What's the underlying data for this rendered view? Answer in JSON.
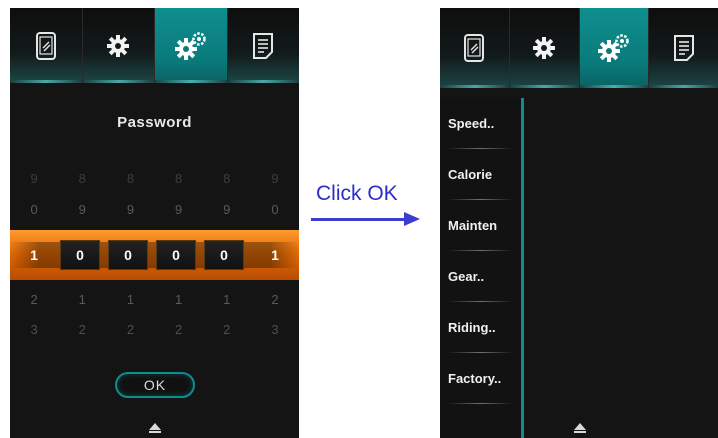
{
  "tabs": [
    {
      "icon": "phone-icon"
    },
    {
      "icon": "gear-icon"
    },
    {
      "icon": "gears-icon",
      "active": true
    },
    {
      "icon": "document-icon"
    }
  ],
  "password_screen": {
    "title": "Password",
    "rows": {
      "row_9": [
        "9",
        "8",
        "8",
        "8",
        "8",
        "9"
      ],
      "row_0": [
        "0",
        "9",
        "9",
        "9",
        "9",
        "0"
      ],
      "selected": [
        "1",
        "0",
        "0",
        "0",
        "0",
        "1"
      ],
      "row_2": [
        "2",
        "1",
        "1",
        "1",
        "1",
        "2"
      ],
      "row_3": [
        "3",
        "2",
        "2",
        "2",
        "2",
        "3"
      ]
    },
    "ok_label": "OK"
  },
  "annotation": {
    "label": "Click OK"
  },
  "menu_screen": {
    "items": [
      "Speed..",
      "Calorie",
      "Mainten",
      "Gear..",
      "Riding..",
      "Factory.."
    ]
  },
  "colors": {
    "teal": "#0d8d8e",
    "orange": "#e36b06",
    "annotation_blue": "#2b2ec9",
    "screen_bg": "#141414"
  }
}
